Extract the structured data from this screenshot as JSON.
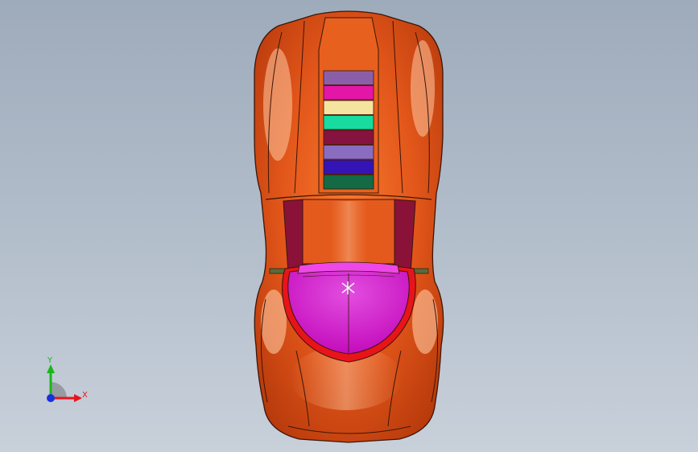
{
  "viewport": {
    "background_top": "#9eabbb",
    "background_bottom": "#c8d0da",
    "view": "top"
  },
  "model": {
    "body_color": "#e2561a",
    "body_highlight": "#ffb07a",
    "canopy_color": "#d818cf",
    "canopy_rim_color": "#e8141a",
    "door_panel_color": "#8a1238",
    "spine_stripe_colors": [
      "#8b5fa8",
      "#e316a8",
      "#f5e4a0",
      "#18dba0",
      "#86123f",
      "#8a6cc0",
      "#3414b4",
      "#136a44"
    ]
  },
  "triad": {
    "x_label": "X",
    "y_label": "Y",
    "x_color": "#e8141a",
    "y_color": "#18b818",
    "z_color": "#1830e0"
  }
}
